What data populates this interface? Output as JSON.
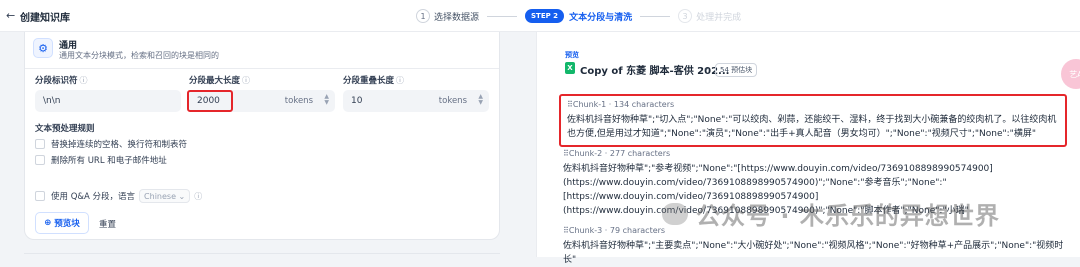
{
  "header": {
    "back_icon": "←",
    "title": "创建知识库",
    "steps": [
      {
        "num": "1",
        "label": "选择数据源"
      },
      {
        "badge": "STEP 2",
        "label": "文本分段与清洗"
      },
      {
        "num": "3",
        "label": "处理并完成"
      }
    ]
  },
  "settings": {
    "mode_title": "通用",
    "mode_desc": "通用文本分块模式，检索和召回的块是相同的",
    "fields": [
      {
        "label": "分段标识符",
        "value": "\\n\\n",
        "unit": ""
      },
      {
        "label": "分段最大长度",
        "value": "2000",
        "unit": "tokens"
      },
      {
        "label": "分段重叠长度",
        "value": "10",
        "unit": "tokens"
      }
    ],
    "rules_title": "文本预处理规则",
    "rules": [
      "替换掉连续的空格、换行符和制表符",
      "删除所有 URL 和电子邮件地址"
    ],
    "qa_label": "使用 Q&A 分段，语言",
    "qa_language": "Chinese",
    "preview_button": "预览块",
    "reset_button": "重置"
  },
  "preview": {
    "label": "预览",
    "doc_name": "Copy of 东菱 脚本-客供 202...",
    "doc_badge": "54 预估块",
    "chunks": [
      {
        "head": "Chunk-1 · 134 characters",
        "body": "佐料机抖音好物种草\";\"切入点\";\"None\":\"可以绞肉、剁蒜，还能绞干、湿料，终于找到大小碗兼备的绞肉机了。以往绞肉机也方便,但是用过才知道\";\"None\":\"演员\";\"None\":\"出手+真人配音（男女均可）\";\"None\":\"视频尺寸\";\"None\":\"横屏\""
      },
      {
        "head": "Chunk-2 · 277 characters",
        "body": "佐料机抖音好物种草\";\"参考视频\";\"None\":\"[https://www.douyin.com/video/7369108898990574900](https://www.douyin.com/video/7369108898990574900)\";\"None\":\"参考音乐\";\"None\":\"[https://www.douyin.com/video/7369108898990574900](https://www.douyin.com/video/7369108898990574900)\";\"None\":\"脚本作者\";\"None\":\"小瑞\""
      },
      {
        "head": "Chunk-3 · 79 characters",
        "body": "佐料机抖音好物种草\";\"主要卖点\";\"None\":\"大小碗好处\";\"None\":\"视频风格\";\"None\":\"好物种草+产品展示\";\"None\":\"视频时长\""
      }
    ],
    "avatar_text": "艺A"
  },
  "watermark": "公众号 · 木乐乐的异想世界"
}
